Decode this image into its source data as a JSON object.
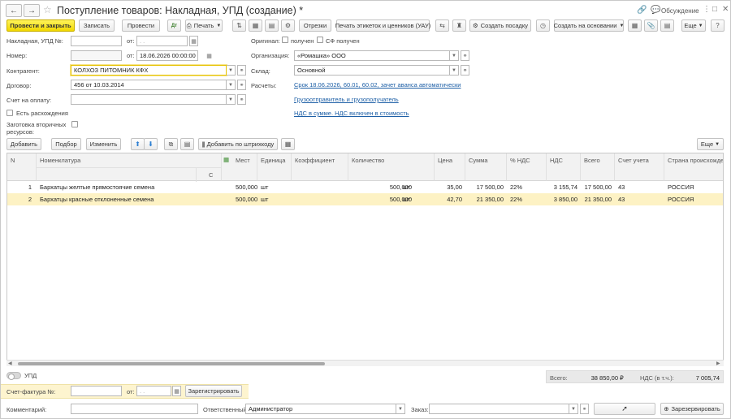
{
  "window": {
    "title": "Поступление товаров: Накладная, УПД (создание) *",
    "discussion_label": "Обсуждение"
  },
  "toolbar": {
    "post_close": "Провести и закрыть",
    "save": "Записать",
    "post": "Провести",
    "print": "Печать",
    "cuts": "Отрезки",
    "print_labels": "Печать этикеток и ценников (УАУ)",
    "create_landing": "Создать посадку",
    "create_based": "Создать на основании",
    "more": "Еще",
    "help": "?"
  },
  "form": {
    "invoice_label": "Накладная, УПД №:",
    "invoice_value": "",
    "from_label": "от:",
    "invoice_date_placeholder": ". .",
    "number_label": "Номер:",
    "number_value": "",
    "number_date": "18.06.2026 00:00:00",
    "counterparty_label": "Контрагент:",
    "counterparty_value": "КОЛХОЗ ПИТОМНИК КФХ",
    "contract_label": "Договор:",
    "contract_value": "456 от 10.03.2014",
    "invoice_pay_label": "Счет на оплату:",
    "invoice_pay_value": "",
    "discrepancies_label": "Есть расхождения",
    "secondary_label_1": "Заготовка вторичных",
    "secondary_label_2": "ресурсов:",
    "original_label": "Оригинал:",
    "received_label": "получен",
    "sf_received_label": "СФ получен",
    "org_label": "Организация:",
    "org_value": "«Ромашка» ООО",
    "warehouse_label": "Склад:",
    "warehouse_value": "Основной",
    "settlements_label": "Расчеты:",
    "settlements_link": "Срок 18.06.2026, 60.01, 60.02, зачет аванса автоматически",
    "shipper_link": "Грузоотправитель и грузополучатель",
    "vat_link": "НДС в сумме. НДС включен в стоимость"
  },
  "table_toolbar": {
    "add": "Добавить",
    "pick": "Подбор",
    "change": "Изменить",
    "barcode": "Добавить по штрихкоду",
    "more": "Еще"
  },
  "table": {
    "headers": {
      "n": "N",
      "nomenclature": "Номенклатура",
      "c": "С",
      "places": "Мест",
      "unit": "Единица",
      "coef": "Коэффициент",
      "qty": "Количество",
      "price": "Цена",
      "sum": "Сумма",
      "vat_pct": "% НДС",
      "vat": "НДС",
      "total": "Всего",
      "account": "Счет учета",
      "country": "Страна происхожде..."
    },
    "rows": [
      {
        "n": "1",
        "name": "Бархатцы желтые прямостоячие семена",
        "places": "500,000",
        "unit": "шт",
        "qty": "500,000",
        "qty_unit": "шт",
        "price": "35,00",
        "sum": "17 500,00",
        "vat_pct": "22%",
        "vat": "3 155,74",
        "total": "17 500,00",
        "account": "43",
        "country": "РОССИЯ"
      },
      {
        "n": "2",
        "name": "Бархатцы красные отклоненные семена",
        "places": "500,000",
        "unit": "шт",
        "qty": "500,000",
        "qty_unit": "шт",
        "price": "42,70",
        "sum": "21 350,00",
        "vat_pct": "22%",
        "vat": "3 850,00",
        "total": "21 350,00",
        "account": "43",
        "country": "РОССИЯ"
      }
    ]
  },
  "footer": {
    "upd_label": "УПД",
    "total_label": "Всего:",
    "total_value": "38 850,00",
    "currency": "₽",
    "vat_label": "НДС (в т.ч.):",
    "vat_value": "7 005,74",
    "sf_label": "Счет-фактура №:",
    "sf_from": "от:",
    "sf_date_placeholder": ". .",
    "register": "Зарегистрировать",
    "comment_label": "Комментарий:",
    "comment_value": "",
    "responsible_label": "Ответственный:",
    "responsible_value": "Администратор",
    "order_label": "Заказ:",
    "order_value": "",
    "reserve": "Зарезервировать"
  },
  "colors": {
    "primary": "#f2d800",
    "link": "#1d5fa6",
    "selected_row": "#fdf2c4",
    "sf_panel": "#fdf4cf"
  }
}
